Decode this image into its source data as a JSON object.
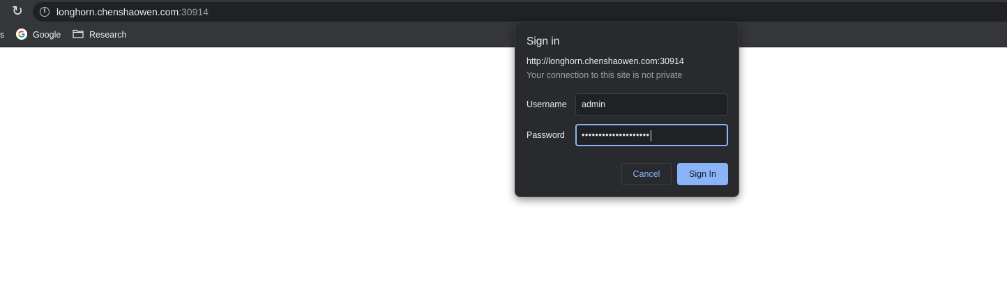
{
  "browser": {
    "url_host": "longhorn.chenshaowen.com",
    "url_port": ":30914",
    "icons": {
      "reload": "reload-icon",
      "site_info": "info-icon"
    }
  },
  "bookmarks": {
    "items": [
      {
        "label": "s",
        "icon": ""
      },
      {
        "label": "Google",
        "icon": "google-icon"
      },
      {
        "label": "Research",
        "icon": "folder-icon"
      }
    ]
  },
  "dialog": {
    "title": "Sign in",
    "origin": "http://longhorn.chenshaowen.com:30914",
    "warning": "Your connection to this site is not private",
    "username_label": "Username",
    "username_value": "admin",
    "password_label": "Password",
    "password_mask": "••••••••••••••••••••",
    "cancel_label": "Cancel",
    "signin_label": "Sign In"
  },
  "colors": {
    "toolbar_bg": "#35363a",
    "dialog_bg": "#292a2d",
    "accent": "#8ab4f8",
    "text": "#e8eaed",
    "muted_text": "#9aa0a6"
  }
}
